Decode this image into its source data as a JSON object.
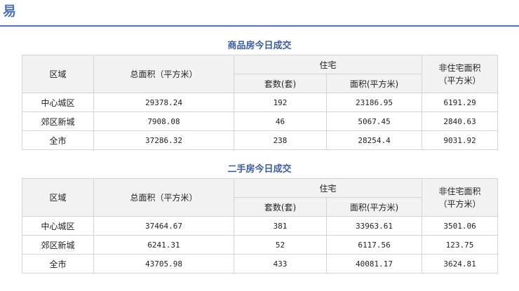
{
  "header": {
    "title": "易"
  },
  "columns": {
    "region": "区域",
    "total_area": "总面积（平方米）",
    "residential": "住宅",
    "units": "套数(套)",
    "res_area": "面积(平方米)",
    "nonres_line1": "非住宅面积",
    "nonres_line2": "（平方米）"
  },
  "sections": [
    {
      "title": "商品房今日成交",
      "rows": [
        {
          "region": "中心城区",
          "total_area": "29378.24",
          "units": "192",
          "res_area": "23186.95",
          "nonres_area": "6191.29"
        },
        {
          "region": "郊区新城",
          "total_area": "7908.08",
          "units": "46",
          "res_area": "5067.45",
          "nonres_area": "2840.63"
        },
        {
          "region": "全市",
          "total_area": "37286.32",
          "units": "238",
          "res_area": "28254.4",
          "nonres_area": "9031.92"
        }
      ]
    },
    {
      "title": "二手房今日成交",
      "rows": [
        {
          "region": "中心城区",
          "total_area": "37464.67",
          "units": "381",
          "res_area": "33963.61",
          "nonres_area": "3501.06"
        },
        {
          "region": "郊区新城",
          "total_area": "6241.31",
          "units": "52",
          "res_area": "6117.56",
          "nonres_area": "123.75"
        },
        {
          "region": "全市",
          "total_area": "43705.98",
          "units": "433",
          "res_area": "40081.17",
          "nonres_area": "3624.81"
        }
      ]
    }
  ]
}
